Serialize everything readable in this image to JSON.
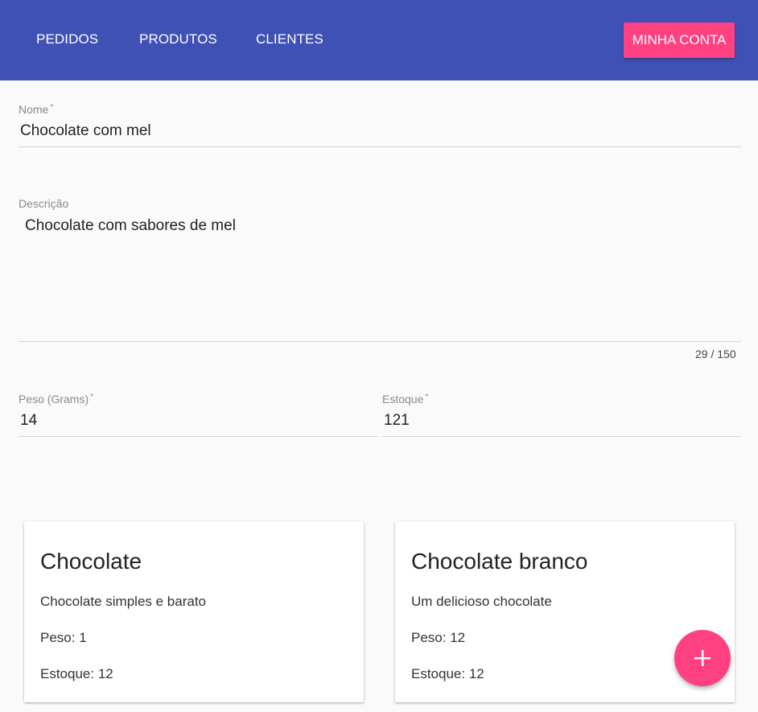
{
  "nav": {
    "items": [
      "PEDIDOS",
      "PRODUTOS",
      "CLIENTES"
    ],
    "account_label": "MINHA CONTA"
  },
  "form": {
    "nome": {
      "label": "Nome",
      "required": "*",
      "value": "Chocolate com mel"
    },
    "descricao": {
      "label": "Descrição",
      "value": "Chocolate com sabores de mel",
      "counter": "29 / 150"
    },
    "peso": {
      "label": "Peso (Grams)",
      "required": "*",
      "value": "14"
    },
    "estoque": {
      "label": "Estoque",
      "required": "*",
      "value": "121"
    }
  },
  "products": [
    {
      "title": "Chocolate",
      "description": "Chocolate simples e barato",
      "peso": "Peso: 1",
      "estoque": "Estoque: 12"
    },
    {
      "title": "Chocolate branco",
      "description": "Um delicioso chocolate",
      "peso": "Peso: 12",
      "estoque": "Estoque: 12"
    }
  ],
  "fab": {
    "icon": "plus-icon"
  },
  "colors": {
    "primary": "#3f51b5",
    "accent": "#ff4081"
  }
}
